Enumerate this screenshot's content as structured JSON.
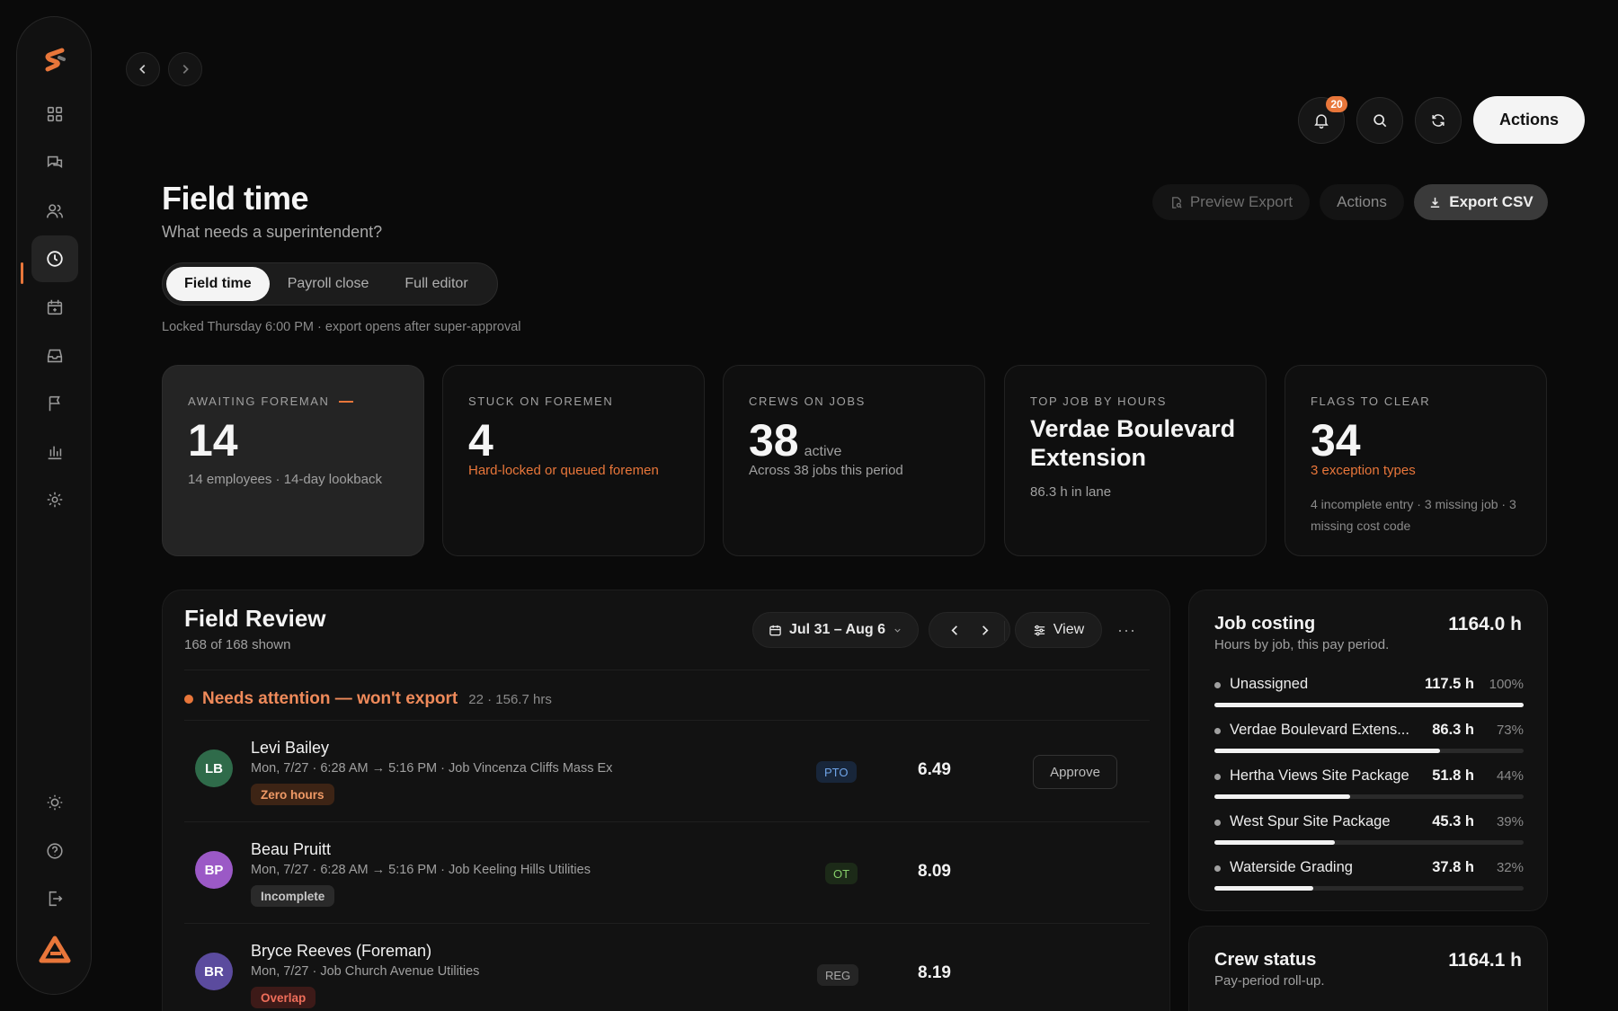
{
  "app": {
    "notifications_count": "20",
    "primary_action": "Actions"
  },
  "sidebar": {
    "items": [
      {
        "icon": "dashboard-icon"
      },
      {
        "icon": "chat-icon"
      },
      {
        "icon": "users-icon"
      },
      {
        "icon": "clock-icon",
        "active": true
      },
      {
        "icon": "calendar-icon"
      },
      {
        "icon": "inbox-icon"
      },
      {
        "icon": "flag-icon"
      },
      {
        "icon": "bar-chart-icon"
      },
      {
        "icon": "settings-icon"
      }
    ],
    "bottom": [
      {
        "icon": "sun-icon"
      },
      {
        "icon": "help-icon"
      },
      {
        "icon": "logout-icon"
      }
    ]
  },
  "header": {
    "title": "Field time",
    "subtitle": "What needs a superintendent?",
    "preview_export": "Preview Export",
    "actions": "Actions",
    "export_csv": "Export CSV"
  },
  "tabs": [
    {
      "label": "Field time",
      "active": true
    },
    {
      "label": "Payroll close",
      "active": false
    },
    {
      "label": "Full editor",
      "active": false
    }
  ],
  "locked_note": "Locked Thursday 6:00 PM · export opens after super-approval",
  "stats": {
    "awaiting": {
      "label": "AWAITING FOREMAN",
      "value": "14",
      "sub": "14 employees · 14-day lookback"
    },
    "stuck": {
      "label": "STUCK ON FOREMEN",
      "value": "4",
      "sub": "Hard-locked or queued foremen"
    },
    "crews": {
      "label": "CREWS ON JOBS",
      "value": "38",
      "unit": "active",
      "sub": "Across 38 jobs this period"
    },
    "top_job": {
      "label": "TOP JOB BY HOURS",
      "value": "Verdae Boulevard Extension",
      "sub": "86.3 h in lane"
    },
    "flags": {
      "label": "FLAGS TO CLEAR",
      "value": "34",
      "sub": "3 exception types",
      "detail": "4 incomplete entry · 3 missing job · 3 missing cost code"
    }
  },
  "review": {
    "title": "Field Review",
    "subtitle": "168 of 168 shown",
    "date_range": "Jul 31 – Aug 6",
    "view_label": "View",
    "more": "···",
    "attention_label": "Needs attention — won't export",
    "attention_meta": "22 · 156.7 hrs",
    "approve_label": "Approve",
    "rows": [
      {
        "initials": "LB",
        "avatar_color": "#2f6b4a",
        "name": "Levi Bailey",
        "meta": "Mon, 7/27 · 6:28 AM → 5:16 PM · Job Vincenza Cliffs Mass Ex",
        "tag": "Zero hours",
        "tag_style": "orange",
        "type": "PTO",
        "type_style": "pto",
        "hours": "6.49",
        "approve": true
      },
      {
        "initials": "BP",
        "avatar_color": "#9b59c6",
        "name": "Beau Pruitt",
        "meta": "Mon, 7/27 · 6:28 AM → 5:16 PM · Job Keeling Hills Utilities",
        "tag": "Incomplete",
        "tag_style": "gray",
        "type": "OT",
        "type_style": "ot",
        "hours": "8.09",
        "approve": false
      },
      {
        "initials": "BR",
        "avatar_color": "#5b4b9e",
        "name": "Bryce Reeves (Foreman)",
        "meta": "Mon, 7/27 · Job Church Avenue Utilities",
        "tag": "Overlap",
        "tag_style": "red",
        "type": "REG",
        "type_style": "reg",
        "hours": "8.19",
        "approve": false
      }
    ]
  },
  "job_costing": {
    "title": "Job costing",
    "subtitle": "Hours by job, this pay period.",
    "total": "1164.0 h",
    "jobs": [
      {
        "name": "Unassigned",
        "hours": "117.5 h",
        "pct": "100%",
        "fill": 100
      },
      {
        "name": "Verdae Boulevard Extens...",
        "hours": "86.3 h",
        "pct": "73%",
        "fill": 73
      },
      {
        "name": "Hertha Views Site Package",
        "hours": "51.8 h",
        "pct": "44%",
        "fill": 44
      },
      {
        "name": "West Spur Site Package",
        "hours": "45.3 h",
        "pct": "39%",
        "fill": 39
      },
      {
        "name": "Waterside Grading",
        "hours": "37.8 h",
        "pct": "32%",
        "fill": 32
      }
    ]
  },
  "crew_status": {
    "title": "Crew status",
    "subtitle": "Pay-period roll-up.",
    "total": "1164.1 h"
  }
}
